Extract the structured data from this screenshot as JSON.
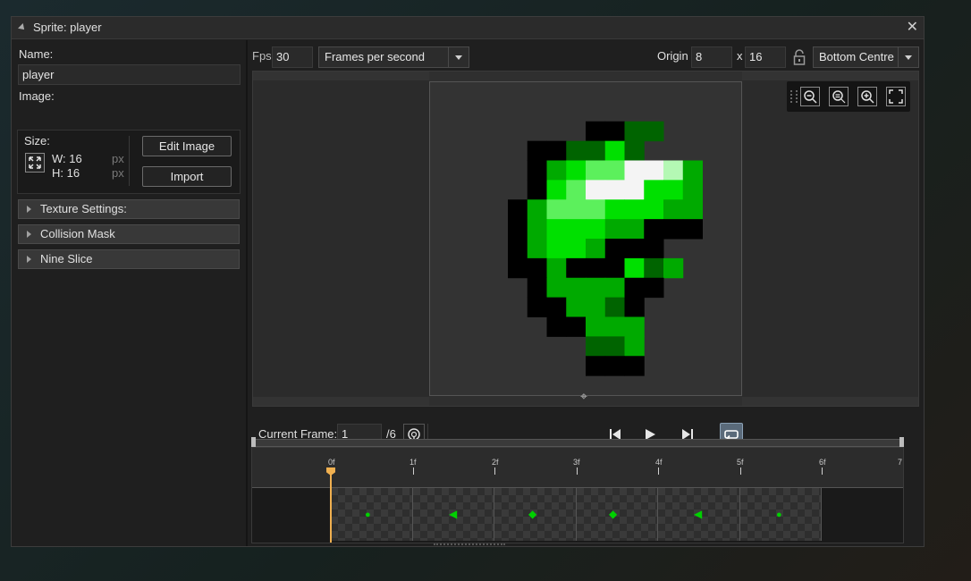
{
  "window": {
    "title": "Sprite: player"
  },
  "left": {
    "name_label": "Name:",
    "name_value": "player",
    "image_label": "Image:",
    "size_label": "Size:",
    "width_label": "W: 16",
    "height_label": "H: 16",
    "px_unit": "px",
    "edit_image": "Edit Image",
    "import": "Import",
    "sections": [
      "Texture Settings:",
      "Collision Mask",
      "Nine Slice"
    ]
  },
  "toolbar": {
    "fps_label": "Fps",
    "fps_value": "30",
    "fps_mode": "Frames per second",
    "origin_label": "Origin",
    "origin_x": "8",
    "origin_sep": "x",
    "origin_y": "16",
    "origin_mode": "Bottom Centre"
  },
  "playback": {
    "current_frame_label": "Current Frame:",
    "current_frame": "1",
    "total_frames": "/6"
  },
  "timeline": {
    "ticks": [
      "0f",
      "1f",
      "2f",
      "3f",
      "4f",
      "5f",
      "6f",
      "7"
    ]
  },
  "colors": {
    "black": "#000000",
    "dark_green": "#006400",
    "green": "#00aa00",
    "bright_green": "#00e000",
    "light_green": "#5cf05c",
    "pale_green": "#b4f8b4",
    "white": "#f4f4f4",
    "playhead": "#f0b050"
  }
}
